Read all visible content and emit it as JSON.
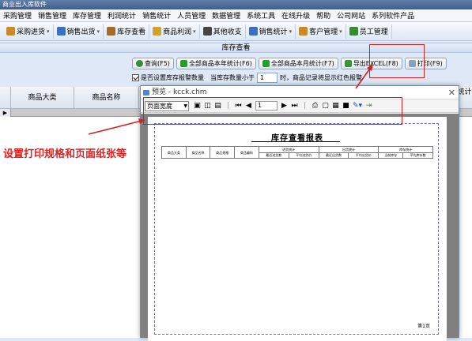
{
  "titlebar": {
    "title": "商业出入库软件"
  },
  "menu": [
    "采购管理",
    "销售管理",
    "库存管理",
    "利润统计",
    "销售统计",
    "人员管理",
    "数据管理",
    "系统工具",
    "在线升级",
    "帮助",
    "公司网站",
    "系列软件产品"
  ],
  "toolbar": [
    {
      "label": "采购进货",
      "icon": "purchase-icon",
      "dropdown": true
    },
    {
      "label": "销售出货",
      "icon": "sales-icon",
      "dropdown": true
    },
    {
      "label": "库存查看",
      "icon": "inventory-icon",
      "dropdown": false
    },
    {
      "label": "商品利润",
      "icon": "profit-icon",
      "dropdown": true
    },
    {
      "label": "其他收支",
      "icon": "other-income-icon",
      "dropdown": false
    },
    {
      "label": "销售统计",
      "icon": "sales-stats-icon",
      "dropdown": true
    },
    {
      "label": "客户管理",
      "icon": "customer-icon",
      "dropdown": true
    },
    {
      "label": "员工管理",
      "icon": "staff-icon",
      "dropdown": false
    }
  ],
  "section": {
    "title": "库存查看"
  },
  "actions": {
    "query": "查询(F5)",
    "year_stats": "全部商品本年统计(F6)",
    "month_stats": "全部商品本月统计(F7)",
    "export": "导出EXCEL(F8)",
    "print": "打印(F9)"
  },
  "alert": {
    "checkbox_label": "是否设置库存报警数量",
    "less_than": "当库存数量小于",
    "value": "1",
    "suffix": "时，商品记录将显示红色报警"
  },
  "grid": {
    "columns": [
      "商品大类",
      "商品名称"
    ],
    "right_col": "统计"
  },
  "preview": {
    "title": "预览 - kcck.chm",
    "zoom": "页面宽度",
    "page": "1",
    "report_title": "库存查看报表",
    "page_number": "第1页",
    "table_groups": [
      "进货统计",
      "出货统计",
      "库存统计"
    ],
    "table_columns": [
      "商品大类",
      "商品名称",
      "商品规格",
      "商品编码",
      "最近进货数",
      "平均进货价",
      "最近出货数",
      "平均出货价",
      "当前库存",
      "平均库存数"
    ]
  },
  "annotation": {
    "text": "设置打印规格和页面纸张等"
  },
  "colors": {
    "annotation": "#e02020",
    "highlight_box": "#d02020",
    "preview_frame": "#6b6bd6"
  }
}
